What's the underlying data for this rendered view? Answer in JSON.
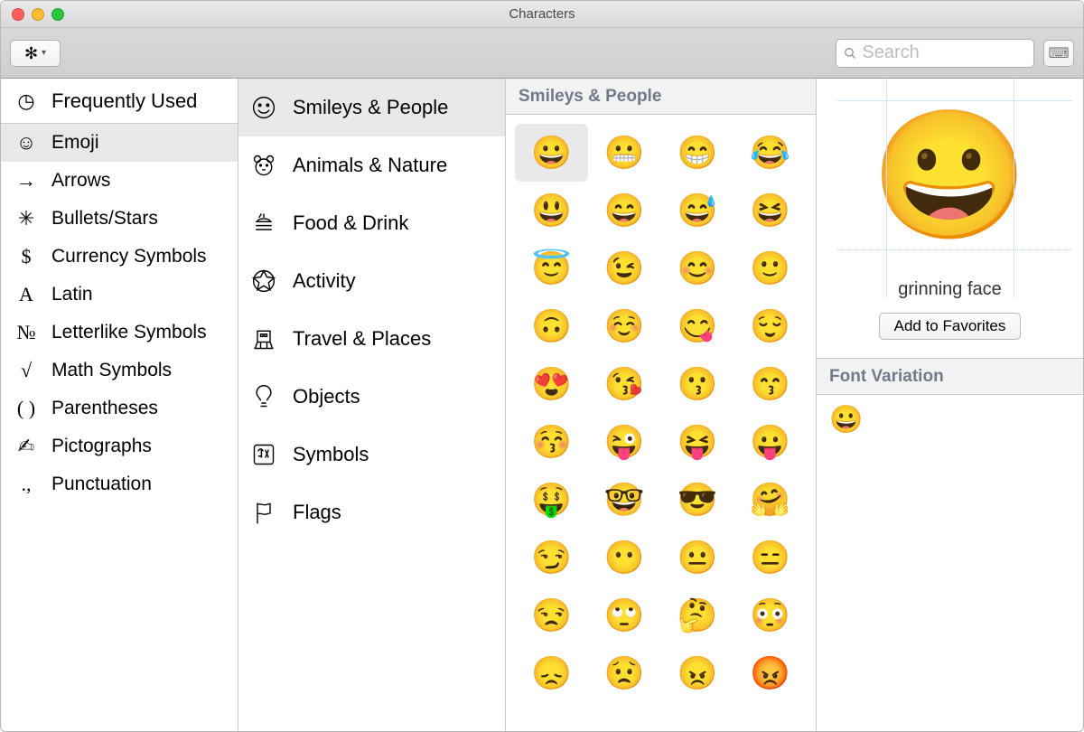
{
  "window": {
    "title": "Characters"
  },
  "search": {
    "placeholder": "Search"
  },
  "sidebar": {
    "items": [
      {
        "icon": "clock",
        "label": "Frequently Used"
      },
      {
        "icon": "emoji",
        "label": "Emoji"
      },
      {
        "icon": "arrow",
        "label": "Arrows"
      },
      {
        "icon": "star",
        "label": "Bullets/Stars"
      },
      {
        "icon": "dollar",
        "label": "Currency Symbols"
      },
      {
        "icon": "latin",
        "label": "Latin"
      },
      {
        "icon": "numero",
        "label": "Letterlike Symbols"
      },
      {
        "icon": "sqrt",
        "label": "Math Symbols"
      },
      {
        "icon": "paren",
        "label": "Parentheses"
      },
      {
        "icon": "picto",
        "label": "Pictographs"
      },
      {
        "icon": "punct",
        "label": "Punctuation"
      }
    ],
    "selected_index": 1
  },
  "subcats": {
    "items": [
      {
        "key": "smileys",
        "label": "Smileys & People"
      },
      {
        "key": "animals",
        "label": "Animals & Nature"
      },
      {
        "key": "food",
        "label": "Food & Drink"
      },
      {
        "key": "activity",
        "label": "Activity"
      },
      {
        "key": "travel",
        "label": "Travel & Places"
      },
      {
        "key": "objects",
        "label": "Objects"
      },
      {
        "key": "symbols",
        "label": "Symbols"
      },
      {
        "key": "flags",
        "label": "Flags"
      }
    ],
    "selected_index": 0
  },
  "grid": {
    "header": "Smileys & People",
    "selected_index": 0,
    "emojis": [
      "😀",
      "😬",
      "😁",
      "😂",
      "😃",
      "😄",
      "😅",
      "😆",
      "😇",
      "😉",
      "😊",
      "🙂",
      "🙃",
      "☺️",
      "😋",
      "😌",
      "😍",
      "😘",
      "😗",
      "😙",
      "😚",
      "😜",
      "😝",
      "😛",
      "🤑",
      "🤓",
      "😎",
      "🤗",
      "😏",
      "😶",
      "😐",
      "😑",
      "😒",
      "🙄",
      "🤔",
      "😳",
      "😞",
      "😟",
      "😠",
      "😡"
    ]
  },
  "detail": {
    "preview_emoji": "😀",
    "name": "grinning face",
    "add_button": "Add to Favorites",
    "variation_header": "Font Variation",
    "variation_emoji": "😀"
  },
  "icons": {
    "clock": "◷",
    "emoji": "☺",
    "arrow": "→",
    "star": "✳︎",
    "dollar": "$",
    "latin": "A",
    "numero": "№",
    "sqrt": "√",
    "paren": "( )",
    "picto": "✍︎",
    "punct": "., "
  }
}
